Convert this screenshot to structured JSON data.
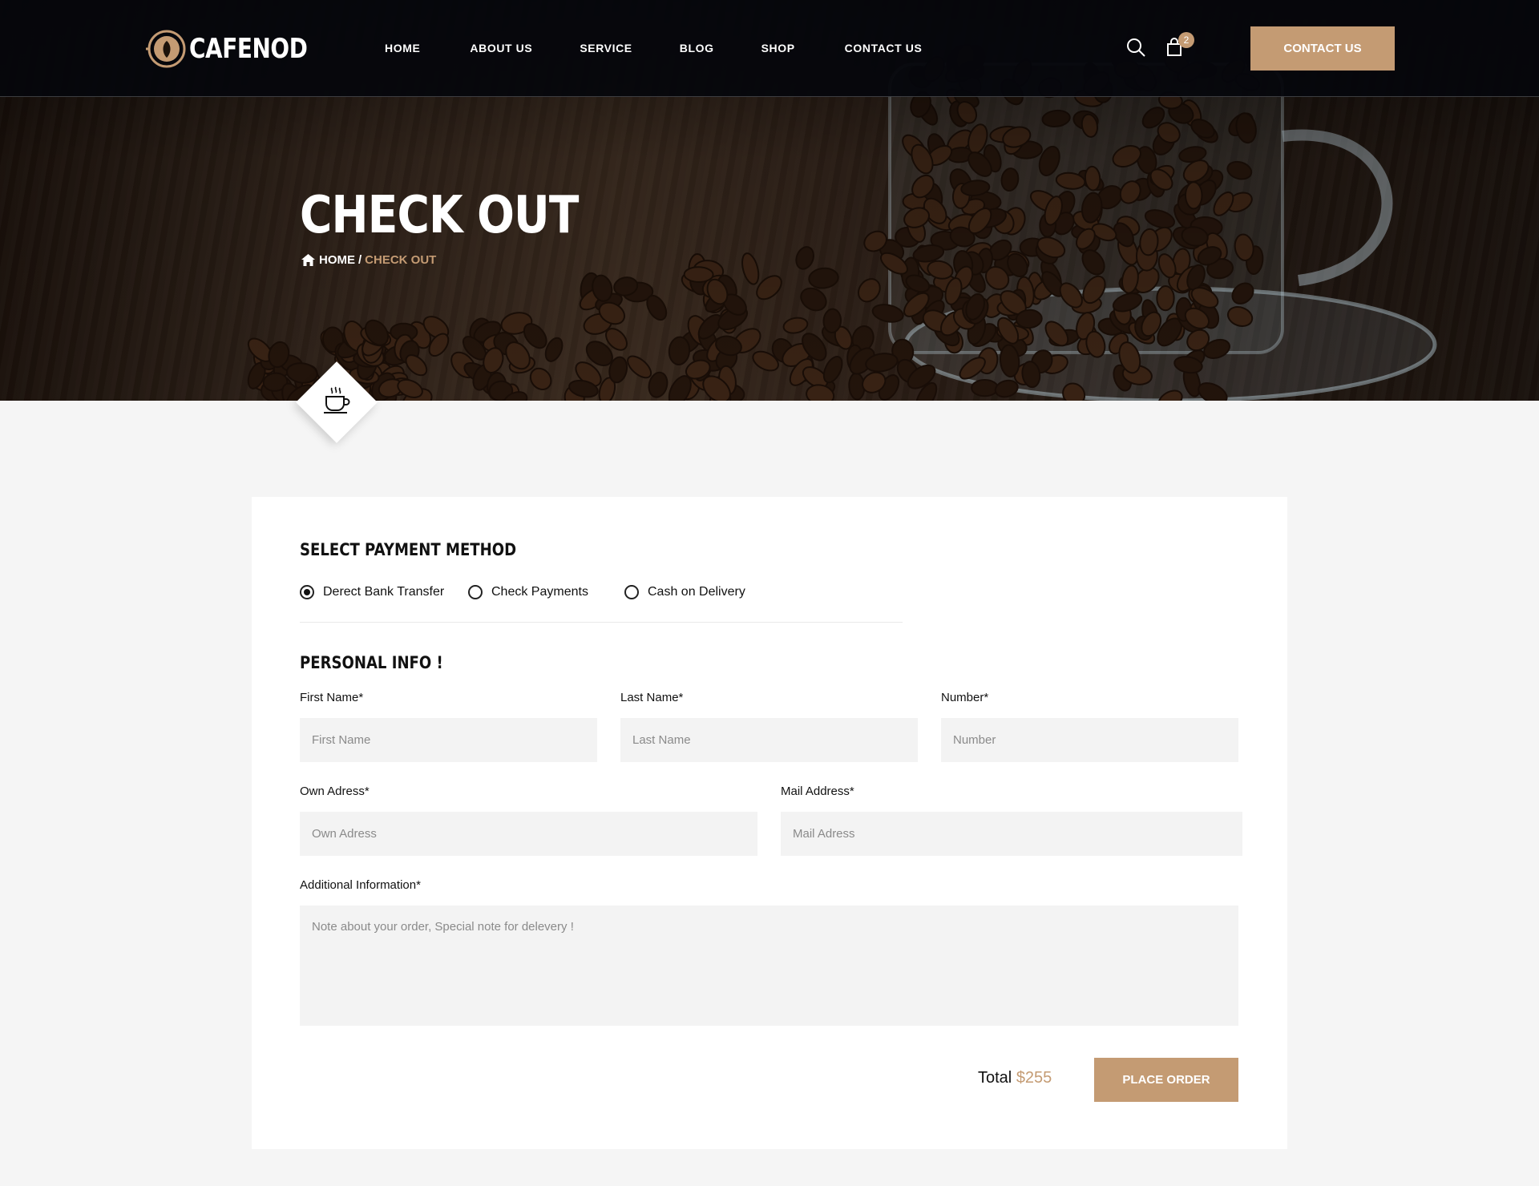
{
  "header": {
    "brand": "CAFENOD",
    "nav": [
      "HOME",
      "ABOUT US",
      "SERVICE",
      "BLOG",
      "SHOP",
      "CONTACT US"
    ],
    "cart_count": "2",
    "contact_button": "CONTACT US",
    "icons": [
      "search-icon",
      "cart-icon"
    ]
  },
  "hero": {
    "title": "CHECK OUT",
    "breadcrumb": {
      "home": "HOME",
      "separator": "/",
      "current": "CHECK OUT"
    }
  },
  "payment": {
    "title": "SELECT PAYMENT METHOD",
    "options": [
      {
        "label": "Derect Bank Transfer",
        "selected": true
      },
      {
        "label": "Check Payments",
        "selected": false
      },
      {
        "label": "Cash on Delivery",
        "selected": false
      }
    ]
  },
  "personal": {
    "title": "PERSONAL INFO !",
    "first_name": {
      "label": "First Name*",
      "placeholder": "First Name"
    },
    "last_name": {
      "label": "Last Name*",
      "placeholder": "Last Name"
    },
    "number": {
      "label": "Number*",
      "placeholder": "Number"
    },
    "own_address": {
      "label": "Own Adress*",
      "placeholder": "Own Adress"
    },
    "mail_address": {
      "label": "Mail Address*",
      "placeholder": "Mail Adress"
    },
    "additional": {
      "label": "Additional Information*",
      "placeholder": "Note about your order, Special note for delevery !"
    }
  },
  "summary": {
    "total_label": "Total",
    "total_value": "$255",
    "place_order": "PLACE ORDER"
  },
  "colors": {
    "accent": "#c49b73",
    "header_bg": "#05060c",
    "field_bg": "#f3f3f3",
    "page_bg": "#f5f5f5"
  }
}
